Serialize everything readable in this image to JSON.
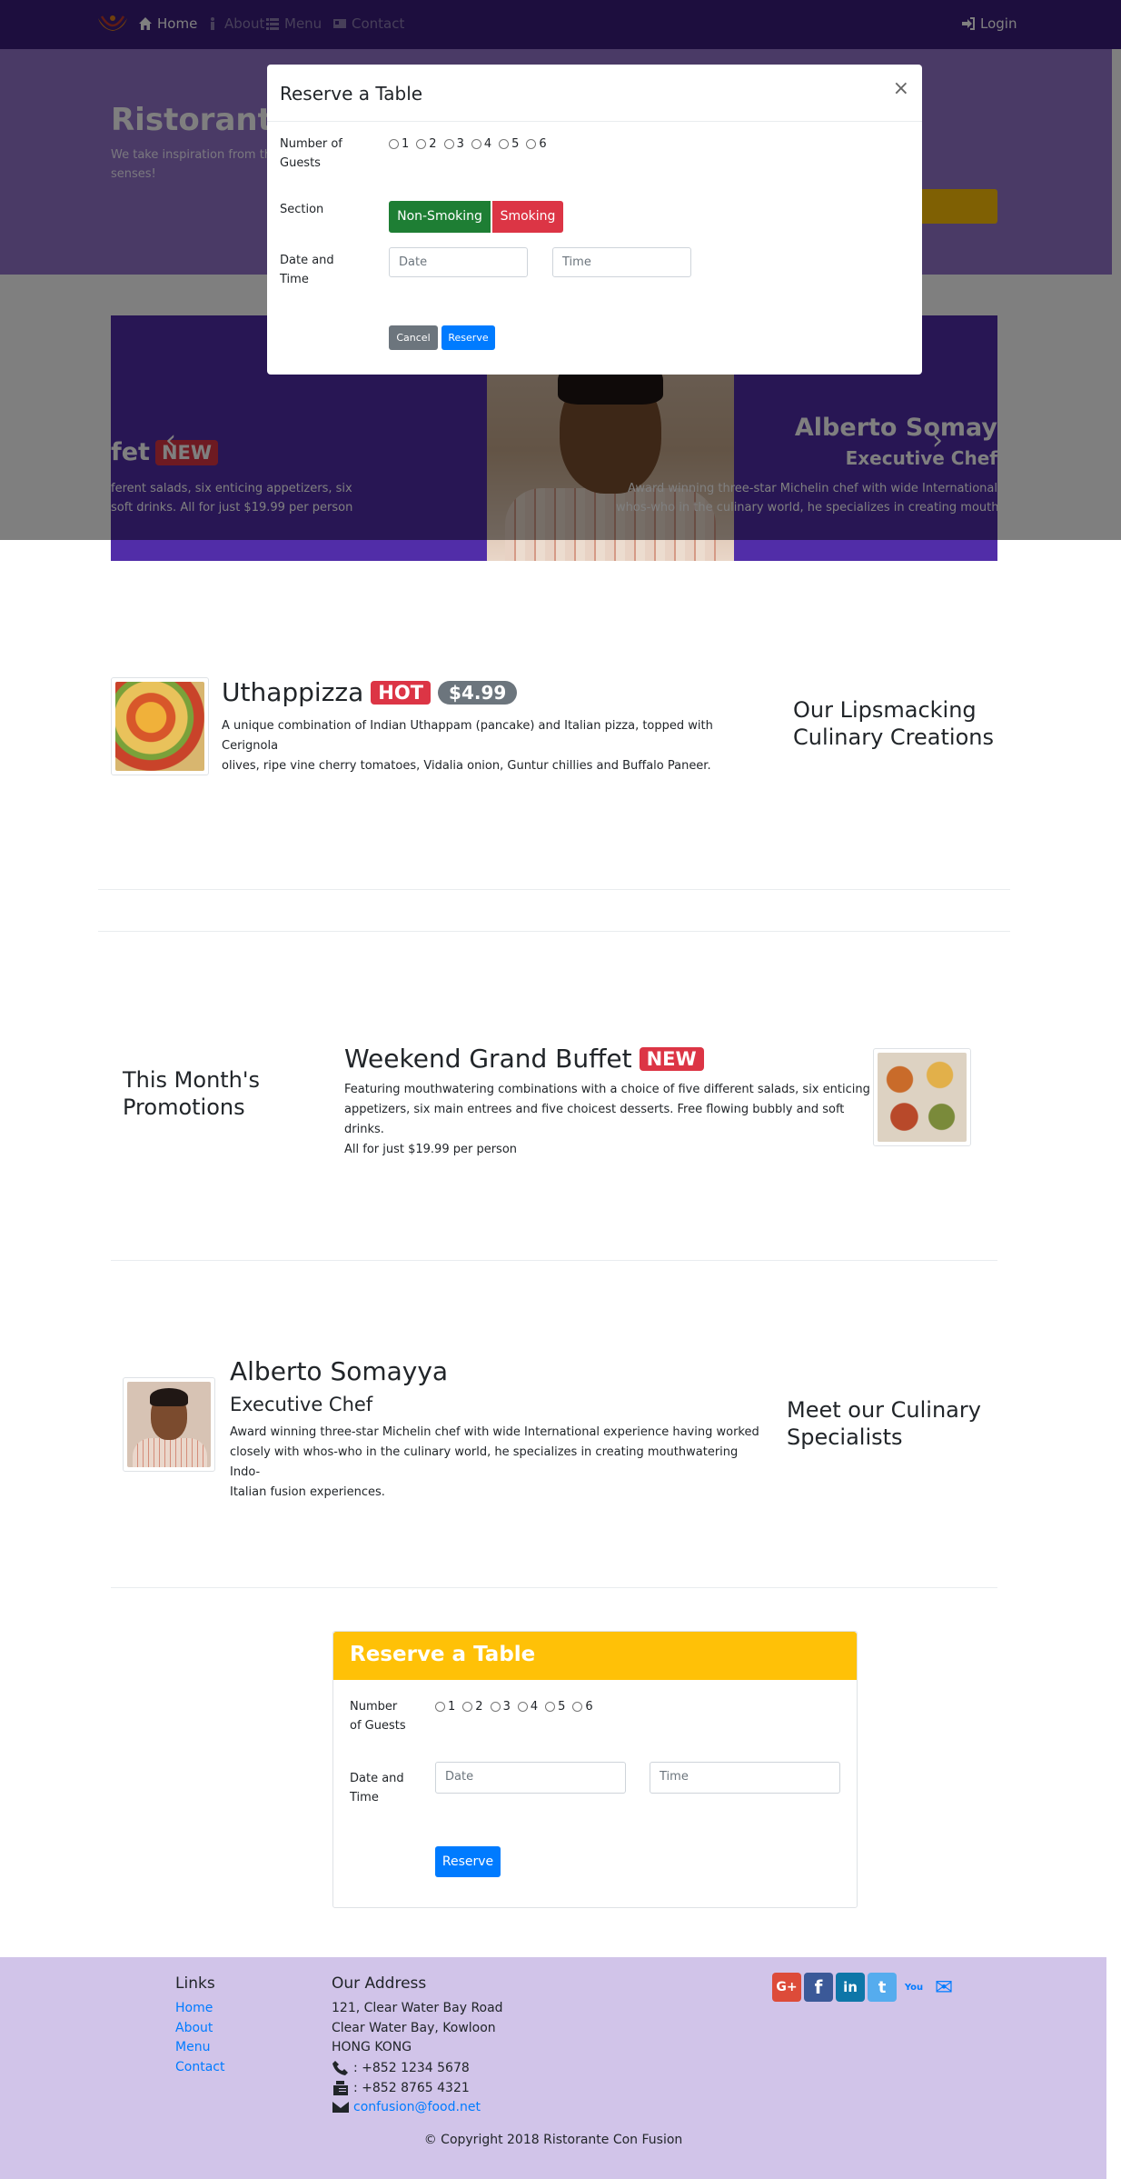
{
  "navbar": {
    "items": [
      {
        "label": "Home",
        "icon": "home-icon"
      },
      {
        "label": "About",
        "icon": "info-icon"
      },
      {
        "label": "Menu",
        "icon": "list-icon"
      },
      {
        "label": "Contact",
        "icon": "address-card-icon"
      }
    ],
    "login": "Login"
  },
  "jumbotron": {
    "title": "Ristorante",
    "text": "We take inspiration from th… fusion experience. Our lips… senses!"
  },
  "carousel": {
    "left_title": "fet",
    "left_badge": "NEW",
    "left_text_1": "ferent salads, six enticing appetizers, six",
    "left_text_2": "soft drinks. All for just $19.99 per person",
    "right_title": "Alberto Somay",
    "right_subtitle": "Executive Chef",
    "right_text_1": "Award winning three-star Michelin chef with wide International",
    "right_text_2": "whos-who in the culinary world, he specializes in creating mouth",
    "prev": "‹",
    "next": "›"
  },
  "modal": {
    "title": "Reserve a Table",
    "close": "×",
    "guests_label_1": "Number of",
    "guests_label_2": "Guests",
    "guest_options": [
      "1",
      "2",
      "3",
      "4",
      "5",
      "6"
    ],
    "section_label": "Section",
    "non_smoking": "Non-Smoking",
    "smoking": "Smoking",
    "datetime_label_1": "Date and",
    "datetime_label_2": "Time",
    "date_placeholder": "Date",
    "time_placeholder": "Time",
    "cancel": "Cancel",
    "reserve": "Reserve"
  },
  "dish": {
    "name": "Uthappizza",
    "badge": "HOT",
    "price": "$4.99",
    "description_1": "A unique combination of Indian Uthappam (pancake) and Italian pizza, topped with Cerignola",
    "description_2": "olives, ripe vine cherry tomatoes, Vidalia onion, Guntur chillies and Buffalo Paneer.",
    "side_heading_1": "Our Lipsmacking",
    "side_heading_2": "Culinary Creations"
  },
  "promotion": {
    "side_heading_1": "This Month's",
    "side_heading_2": "Promotions",
    "name": "Weekend Grand Buffet",
    "badge": "NEW",
    "description_1": "Featuring mouthwatering combinations with a choice of five different salads, six enticing",
    "description_2": "appetizers, six main entrees and five choicest desserts. Free flowing bubbly and soft drinks.",
    "description_3": "All for just $19.99 per person"
  },
  "leader": {
    "name": "Alberto Somayya",
    "designation": "Executive Chef",
    "description_1": "Award winning three-star Michelin chef with wide International experience having worked",
    "description_2": "closely with whos-who in the culinary world, he specializes in creating mouthwatering Indo-",
    "description_3": "Italian fusion experiences.",
    "side_heading_1": "Meet our Culinary",
    "side_heading_2": "Specialists"
  },
  "reserve_card": {
    "title": "Reserve a Table",
    "guests_label_1": "Number",
    "guests_label_2": "of Guests",
    "guest_options": [
      "1",
      "2",
      "3",
      "4",
      "5",
      "6"
    ],
    "datetime_label_1": "Date and",
    "datetime_label_2": "Time",
    "date_placeholder": "Date",
    "time_placeholder": "Time",
    "reserve": "Reserve"
  },
  "footer": {
    "links_heading": "Links",
    "links": [
      "Home",
      "About",
      "Menu",
      "Contact"
    ],
    "address_heading": "Our Address",
    "address_1": "121, Clear Water Bay Road",
    "address_2": "Clear Water Bay, Kowloon",
    "address_3": "HONG KONG",
    "phone": ": +852 1234 5678",
    "fax": ": +852 8765 4321",
    "email": "confusion@food.net",
    "social": [
      {
        "icon": "google-plus-icon",
        "color": "#dd4b39",
        "glyph": "G+"
      },
      {
        "icon": "facebook-icon",
        "color": "#3b5998",
        "glyph": "f"
      },
      {
        "icon": "linkedin-icon",
        "color": "#0e76a8",
        "glyph": "in"
      },
      {
        "icon": "twitter-icon",
        "color": "#55acee",
        "glyph": "t"
      },
      {
        "icon": "youtube-icon",
        "color": "#007bff",
        "glyph": "You"
      },
      {
        "icon": "mail-icon",
        "color": "#007bff",
        "glyph": "✉"
      }
    ],
    "copyright": "© Copyright 2018 Ristorante Con Fusion"
  },
  "colors": {
    "navbar": "#3b1d7c",
    "jumbotron": "#9575cd",
    "carousel": "#512da8",
    "footer": "#d1c4e9",
    "card_header": "#ffc107"
  }
}
